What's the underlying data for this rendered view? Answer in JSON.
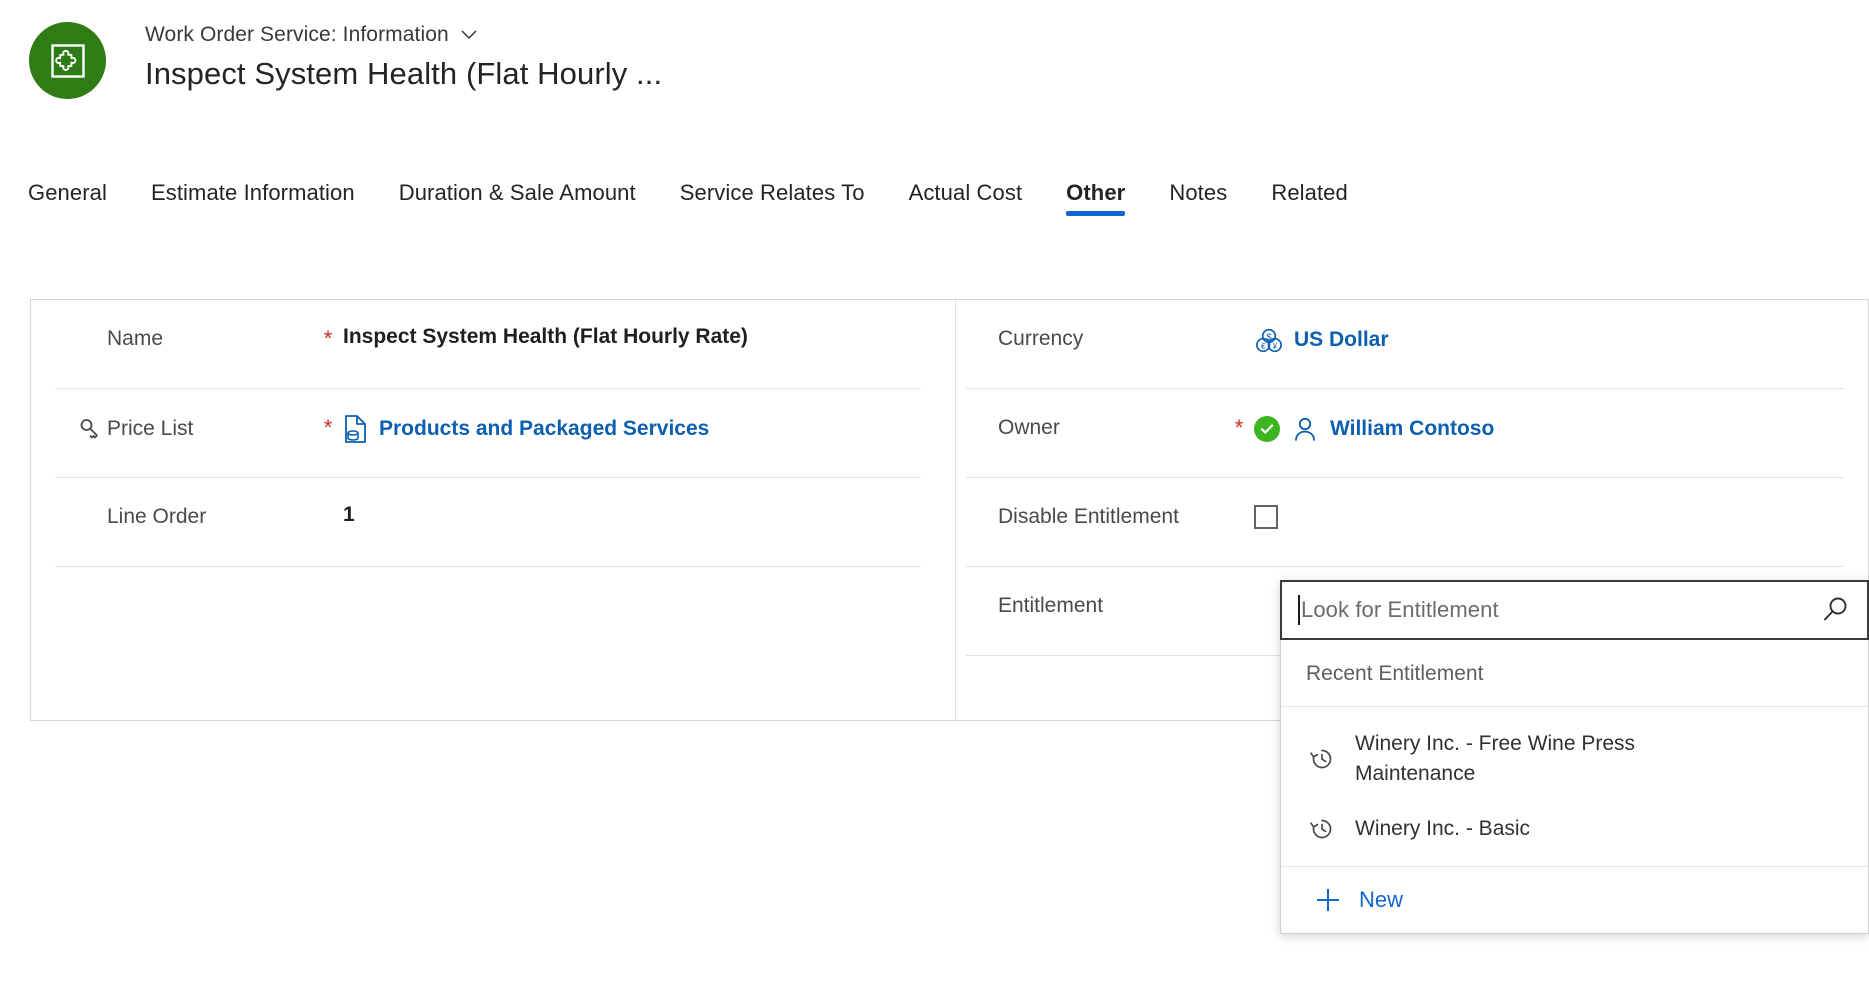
{
  "header": {
    "avatar_icon": "puzzle-piece-icon",
    "avatar_color": "#2E7D14",
    "breadcrumb": "Work Order Service: Information",
    "breadcrumb_chevron_icon": "chevron-down-icon",
    "record_title": "Inspect System Health (Flat Hourly ..."
  },
  "tabs": {
    "accent_color": "#1266CD",
    "items": [
      {
        "label": "General",
        "active": false
      },
      {
        "label": "Estimate Information",
        "active": false
      },
      {
        "label": "Duration & Sale Amount",
        "active": false
      },
      {
        "label": "Service Relates To",
        "active": false
      },
      {
        "label": "Actual Cost",
        "active": false
      },
      {
        "label": "Other",
        "active": true
      },
      {
        "label": "Notes",
        "active": false
      },
      {
        "label": "Related",
        "active": false
      }
    ]
  },
  "form": {
    "left_column": {
      "name": {
        "label": "Name",
        "required_marker": "*",
        "value": "Inspect System Health (Flat Hourly Rate)"
      },
      "price_list": {
        "label": "Price List",
        "label_icon": "key-icon",
        "required_marker": "*",
        "value": "Products and Packaged Services",
        "value_icon": "price-list-icon",
        "link_color": "#0D5FAF"
      },
      "line_order": {
        "label": "Line Order",
        "value": "1"
      }
    },
    "right_column": {
      "currency": {
        "label": "Currency",
        "value": "US Dollar",
        "value_icon": "currency-coins-icon",
        "link_color": "#0D5FAF"
      },
      "owner": {
        "label": "Owner",
        "required_marker": "*",
        "status_icon": "check-circle-icon",
        "status_color": "#3CB521",
        "value_icon": "person-icon",
        "value": "William Contoso",
        "link_color": "#0D5FAF"
      },
      "disable_entitlement": {
        "label": "Disable Entitlement",
        "control": "checkbox",
        "checked": false
      },
      "entitlement": {
        "label": "Entitlement"
      }
    }
  },
  "lookup": {
    "placeholder": "Look for Entitlement",
    "value": "",
    "search_icon": "search-icon",
    "panel_heading": "Recent Entitlement",
    "results": [
      {
        "text": "Winery Inc. - Free Wine Press Maintenance",
        "icon": "recent-clock-icon"
      },
      {
        "text": "Winery Inc. - Basic",
        "icon": "recent-clock-icon"
      }
    ],
    "new_label": "New",
    "new_icon": "plus-icon",
    "new_color": "#1266CD"
  }
}
